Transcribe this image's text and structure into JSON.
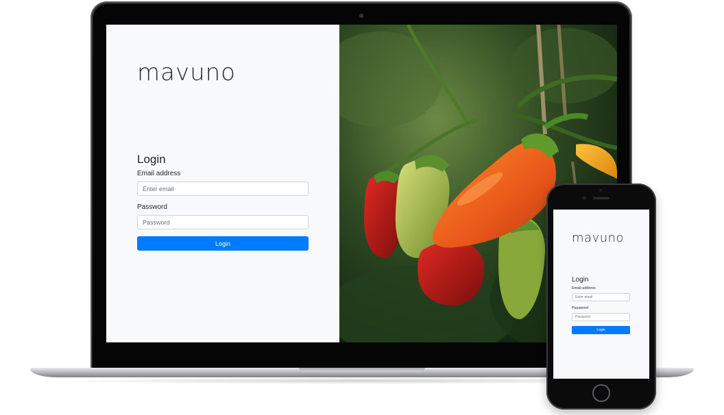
{
  "brand": {
    "logo_text": "mavuno"
  },
  "login_form": {
    "title": "Login",
    "email_label": "Email address",
    "email_placeholder": "Enter email",
    "password_label": "Password",
    "password_placeholder": "Password",
    "submit_label": "Login"
  },
  "colors": {
    "primary_button": "#007bff",
    "panel_background": "#f8f9fa",
    "logo_text": "#1e2a36"
  },
  "hero_image": {
    "subject_icon": "pepper-plant-photo"
  }
}
